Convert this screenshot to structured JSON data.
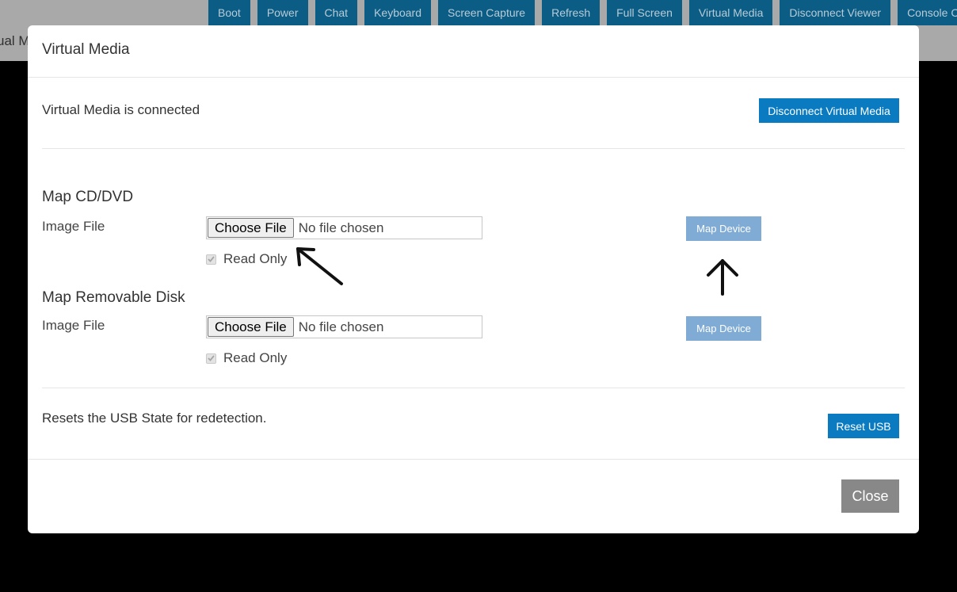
{
  "background": {
    "page_title_partial": "ual M"
  },
  "toolbar": {
    "items": [
      {
        "label": "Boot"
      },
      {
        "label": "Power"
      },
      {
        "label": "Chat"
      },
      {
        "label": "Keyboard"
      },
      {
        "label": "Screen Capture"
      },
      {
        "label": "Refresh"
      },
      {
        "label": "Full Screen"
      },
      {
        "label": "Virtual Media"
      },
      {
        "label": "Disconnect Viewer"
      },
      {
        "label": "Console Cor"
      }
    ]
  },
  "modal": {
    "title": "Virtual Media",
    "status_text": "Virtual Media is connected",
    "disconnect_label": "Disconnect Virtual Media",
    "cd_section": {
      "title": "Map CD/DVD",
      "field_label": "Image File",
      "choose_label": "Choose File",
      "file_status": "No file chosen",
      "read_only_label": "Read Only",
      "read_only_checked": true,
      "map_label": "Map Device"
    },
    "disk_section": {
      "title": "Map Removable Disk",
      "field_label": "Image File",
      "choose_label": "Choose File",
      "file_status": "No file chosen",
      "read_only_label": "Read Only",
      "read_only_checked": true,
      "map_label": "Map Device"
    },
    "usb_text": "Resets the USB State for redetection.",
    "reset_usb_label": "Reset USB",
    "close_label": "Close"
  },
  "colors": {
    "primary": "#0a7bc1",
    "primary_disabled": "#7fabd5",
    "toolbar": "#0b5d86",
    "close": "#888888",
    "overlay": "#000000"
  }
}
